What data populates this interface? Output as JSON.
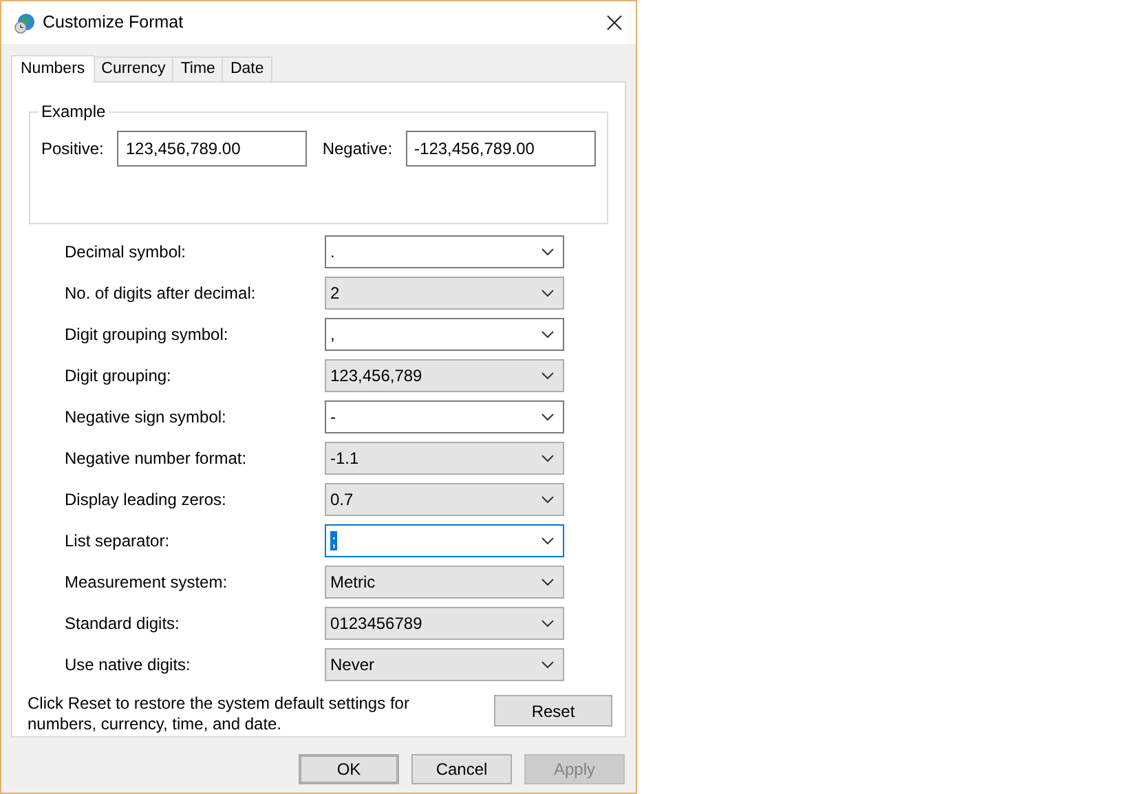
{
  "window": {
    "title": "Customize Format"
  },
  "tabs": [
    {
      "label": "Numbers",
      "selected": true
    },
    {
      "label": "Currency",
      "selected": false
    },
    {
      "label": "Time",
      "selected": false
    },
    {
      "label": "Date",
      "selected": false
    }
  ],
  "example": {
    "title": "Example",
    "positive_label": "Positive:",
    "positive_value": "123,456,789.00",
    "negative_label": "Negative:",
    "negative_value": "-123,456,789.00"
  },
  "settings": [
    {
      "label": "Decimal symbol:",
      "value": ".",
      "kind": "editable",
      "focused": false
    },
    {
      "label": "No. of digits after decimal:",
      "value": "2",
      "kind": "list",
      "focused": false
    },
    {
      "label": "Digit grouping symbol:",
      "value": ",",
      "kind": "editable",
      "focused": false
    },
    {
      "label": "Digit grouping:",
      "value": "123,456,789",
      "kind": "list",
      "focused": false
    },
    {
      "label": "Negative sign symbol:",
      "value": "-",
      "kind": "editable",
      "focused": false
    },
    {
      "label": "Negative number format:",
      "value": "-1.1",
      "kind": "list",
      "focused": false
    },
    {
      "label": "Display leading zeros:",
      "value": "0.7",
      "kind": "list",
      "focused": false
    },
    {
      "label": "List separator:",
      "value": ";",
      "kind": "editable",
      "focused": true
    },
    {
      "label": "Measurement system:",
      "value": "Metric",
      "kind": "list",
      "focused": false
    },
    {
      "label": "Standard digits:",
      "value": "0123456789",
      "kind": "list",
      "focused": false
    },
    {
      "label": "Use native digits:",
      "value": "Never",
      "kind": "list",
      "focused": false
    }
  ],
  "reset_note": "Click Reset to restore the system default settings for numbers, currency, time, and date.",
  "reset_button": "Reset",
  "buttons": [
    {
      "label": "OK",
      "default": true,
      "disabled": false
    },
    {
      "label": "Cancel",
      "default": false,
      "disabled": false
    },
    {
      "label": "Apply",
      "default": false,
      "disabled": true
    }
  ]
}
